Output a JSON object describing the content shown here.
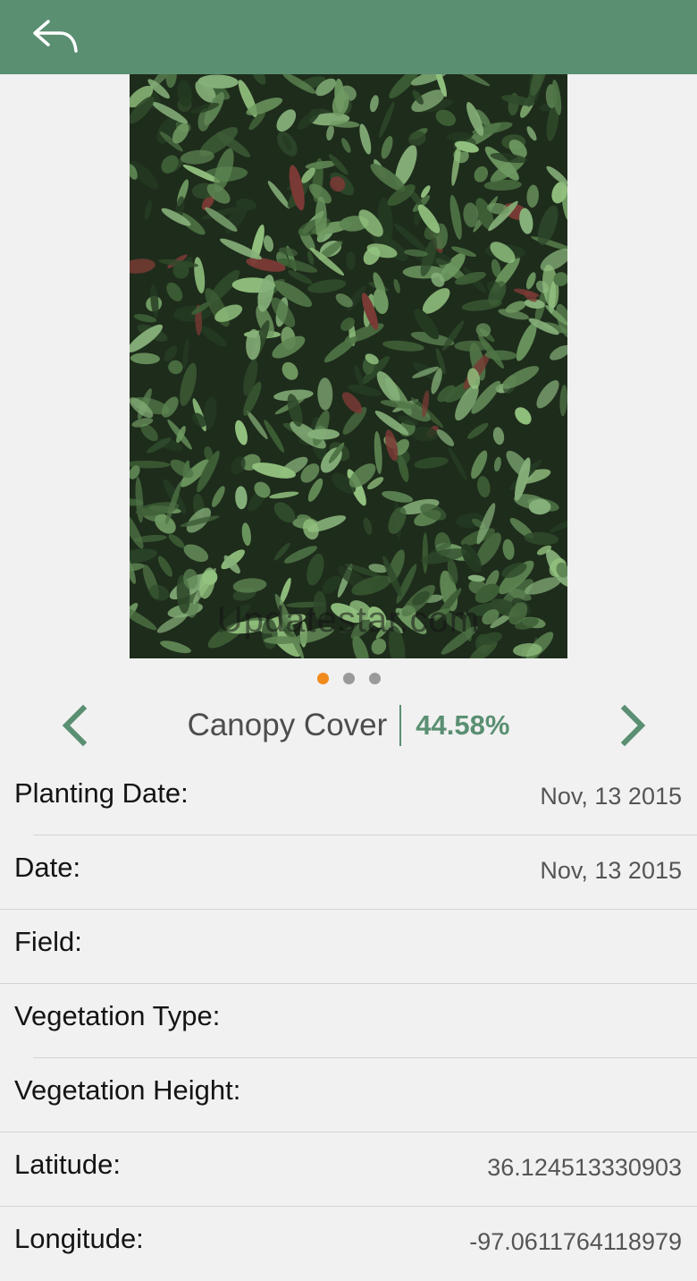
{
  "header": {
    "back_icon": "reply-arrow-icon",
    "background": "#5a8f72"
  },
  "photo": {
    "watermark": "Updatestar.com"
  },
  "pager": {
    "count": 3,
    "active_index": 0,
    "active_color": "#f08a1c",
    "inactive_color": "#9a9a9a"
  },
  "metric": {
    "label": "Canopy Cover",
    "value": "44.58%",
    "prev_icon": "chevron-left-icon",
    "next_icon": "chevron-right-icon",
    "accent": "#5a8f72"
  },
  "details": [
    {
      "label": "Planting Date:",
      "value": "Nov, 13 2015"
    },
    {
      "label": "Date:",
      "value": "Nov, 13 2015"
    },
    {
      "label": "Field:",
      "value": ""
    },
    {
      "label": "Vegetation Type:",
      "value": ""
    },
    {
      "label": "Vegetation Height:",
      "value": ""
    },
    {
      "label": "Latitude:",
      "value": "36.124513330903"
    },
    {
      "label": "Longitude:",
      "value": "-97.0611764118979"
    }
  ]
}
